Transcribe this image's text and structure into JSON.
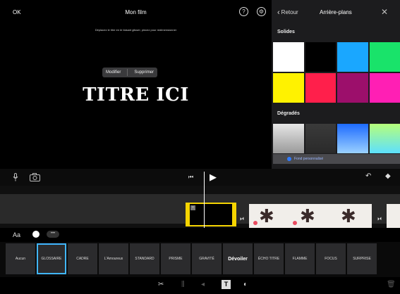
{
  "viewer": {
    "ok_label": "OK",
    "title": "Mon film",
    "help_glyph": "?",
    "settings_glyph": "⚙",
    "hint": "Déplacez le titre en le faisant glisser, pincez pour redimensionner",
    "context_menu": {
      "edit_label": "Modifier",
      "delete_label": "Supprimer"
    },
    "title_text": "TITRE ICI"
  },
  "backgrounds_panel": {
    "back_label": "Retour",
    "title": "Arrière-plans",
    "close_glyph": "✕",
    "solids_label": "Solides",
    "solid_colors": [
      "#ffffff",
      "#000000",
      "#1aa7ff",
      "#19e36a",
      "#fff200",
      "#ff1f4b",
      "#9c0f6b",
      "#ff1fb4"
    ],
    "gradients_label": "Dégradés",
    "gradient_colors": [
      [
        "#e6e6e6",
        "#9a9a9a"
      ],
      [
        "#3a3a3a",
        "#2a2a2a"
      ],
      [
        "#1e6bff",
        "#9bd1ff"
      ],
      [
        "#b6ff7a",
        "#5de0ff"
      ]
    ],
    "selection_bar_text": "Fond personnalisé"
  },
  "toolbar": {
    "mic_icon": "microphone-icon",
    "camera_icon": "camera-icon",
    "prev_glyph": "⏮",
    "play_glyph": "▶",
    "undo_glyph": "↶",
    "keyframe_glyph": "◆"
  },
  "timeline": {
    "transition_glyph": "⏵⏴",
    "clip_badge": "T"
  },
  "style_row": {
    "aa_label": "Aa",
    "more_glyph": "•••"
  },
  "title_styles": [
    {
      "label": "Aucun",
      "selected": false,
      "bold": false
    },
    {
      "label": "GLOSSAIRE",
      "selected": true,
      "bold": false
    },
    {
      "label": "CADRE",
      "selected": false,
      "bold": false
    },
    {
      "label": "L'Amoureux",
      "selected": false,
      "bold": false
    },
    {
      "label": "STANDARD",
      "selected": false,
      "bold": false
    },
    {
      "label": "PRISME",
      "selected": false,
      "bold": false
    },
    {
      "label": "GRAVITÉ",
      "selected": false,
      "bold": false
    },
    {
      "label": "Dévoiler",
      "selected": false,
      "bold": true
    },
    {
      "label": "ÉCHO TITRE",
      "selected": false,
      "bold": false
    },
    {
      "label": "FLAMME",
      "selected": false,
      "bold": false
    },
    {
      "label": "FOCUS",
      "selected": false,
      "bold": false
    },
    {
      "label": "SURPRISE",
      "selected": false,
      "bold": false
    }
  ],
  "bottom_bar": {
    "cut_glyph": "✂",
    "split_glyph": "⫼",
    "volume_glyph": "◂",
    "text_glyph": "T",
    "filter_glyph": "◐",
    "delete_glyph": "🗑"
  }
}
